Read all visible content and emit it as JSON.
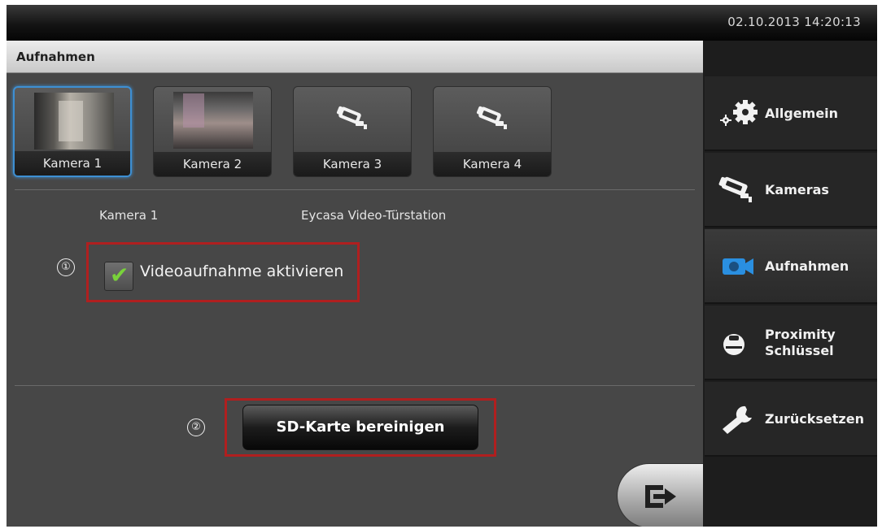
{
  "header": {
    "datetime": "02.10.2013 14:20:13"
  },
  "main": {
    "title": "Aufnahmen",
    "cameras": [
      {
        "label": "Kamera 1",
        "selected": true,
        "thumbnail": "photo"
      },
      {
        "label": "Kamera 2",
        "selected": false,
        "thumbnail": "photo"
      },
      {
        "label": "Kamera 3",
        "selected": false,
        "thumbnail": "camera-icon"
      },
      {
        "label": "Kamera 4",
        "selected": false,
        "thumbnail": "camera-icon"
      }
    ],
    "info": {
      "camera_name": "Kamera 1",
      "station": "Eycasa Video-Türstation"
    },
    "markers": {
      "one": "①",
      "two": "②"
    },
    "record_option": {
      "label": "Videoaufnahme aktivieren",
      "checked": true,
      "check_glyph": "✔"
    },
    "sd_button": {
      "label": "SD-Karte bereinigen"
    },
    "exit_icon": "exit-arrow-icon"
  },
  "sidebar": {
    "items": [
      {
        "label": "Allgemein",
        "icon": "gear-icon",
        "active": false
      },
      {
        "label": "Kameras",
        "icon": "camera-icon",
        "active": false
      },
      {
        "label": "Aufnahmen",
        "icon": "recording-icon",
        "active": true
      },
      {
        "label_line1": "Proximity",
        "label_line2": "Schlüssel",
        "icon": "key-fob-icon",
        "active": false
      },
      {
        "label": "Zurücksetzen",
        "icon": "wrench-icon",
        "active": false
      }
    ]
  },
  "colors": {
    "accent": "#3d8fd3",
    "highlight_frame": "#b01f1f",
    "check": "#79d23a",
    "recording_icon": "#2a8fe0"
  }
}
